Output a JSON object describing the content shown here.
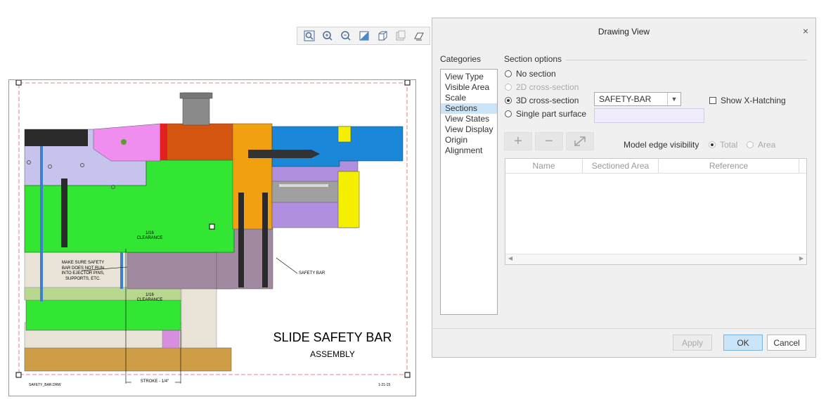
{
  "toolbar": {
    "icons": [
      "zoom-fit-icon",
      "zoom-in-icon",
      "zoom-out-icon",
      "repaint-icon",
      "view-orientation-icon",
      "saved-views-icon",
      "display-style-icon"
    ]
  },
  "drawing": {
    "title_line1": "SLIDE SAFETY BAR",
    "title_line2": "ASSEMBLY",
    "note_clearance_top_1": "1/16",
    "note_clearance_top_2": "CLEARANCE",
    "note_clearance_bottom_1": "1/16",
    "note_clearance_bottom_2": "CLEARANCE",
    "note_make_sure_1": "MAKE SURE SAFETY",
    "note_make_sure_2": "BAR DOES NOT RUN",
    "note_make_sure_3": "INTO EJECTOR PINS,",
    "note_make_sure_4": "SUPPORTS, ETC.",
    "note_safety_bar": "SAFETY BAR",
    "note_stroke": "STROKE - 1/4\"",
    "footer_left": "SAFETY_BAR.DRW",
    "footer_right": "1-21-15"
  },
  "dialog": {
    "title": "Drawing View",
    "close_label": "×",
    "categories_label": "Categories",
    "categories": [
      "View Type",
      "Visible Area",
      "Scale",
      "Sections",
      "View States",
      "View Display",
      "Origin",
      "Alignment"
    ],
    "selected_category": "Sections",
    "section_options_label": "Section options",
    "radio_no_section": "No section",
    "radio_2d": "2D cross-section",
    "radio_3d": "3D cross-section",
    "radio_single_part": "Single part surface",
    "selected_section": "SAFETY-BAR",
    "show_xhatching_label": "Show X-Hatching",
    "model_edge_visibility_label": "Model edge visibility",
    "radio_total": "Total",
    "radio_area": "Area",
    "table_columns": [
      "Name",
      "Sectioned Area",
      "Reference"
    ],
    "apply_label": "Apply",
    "ok_label": "OK",
    "cancel_label": "Cancel"
  },
  "colors": {
    "green": "#33e633",
    "lavender": "#c6c3ec",
    "pink": "#f08ef0",
    "orange_brown": "#d4550f",
    "orange": "#f1a10f",
    "blue": "#1b87d8",
    "yellow": "#f5ef00",
    "purple": "#b08ee0",
    "mauve": "#a18aa0",
    "tan": "#cf9d45",
    "beige": "#e9e3d8",
    "selected_bg": "#cce4f7"
  }
}
